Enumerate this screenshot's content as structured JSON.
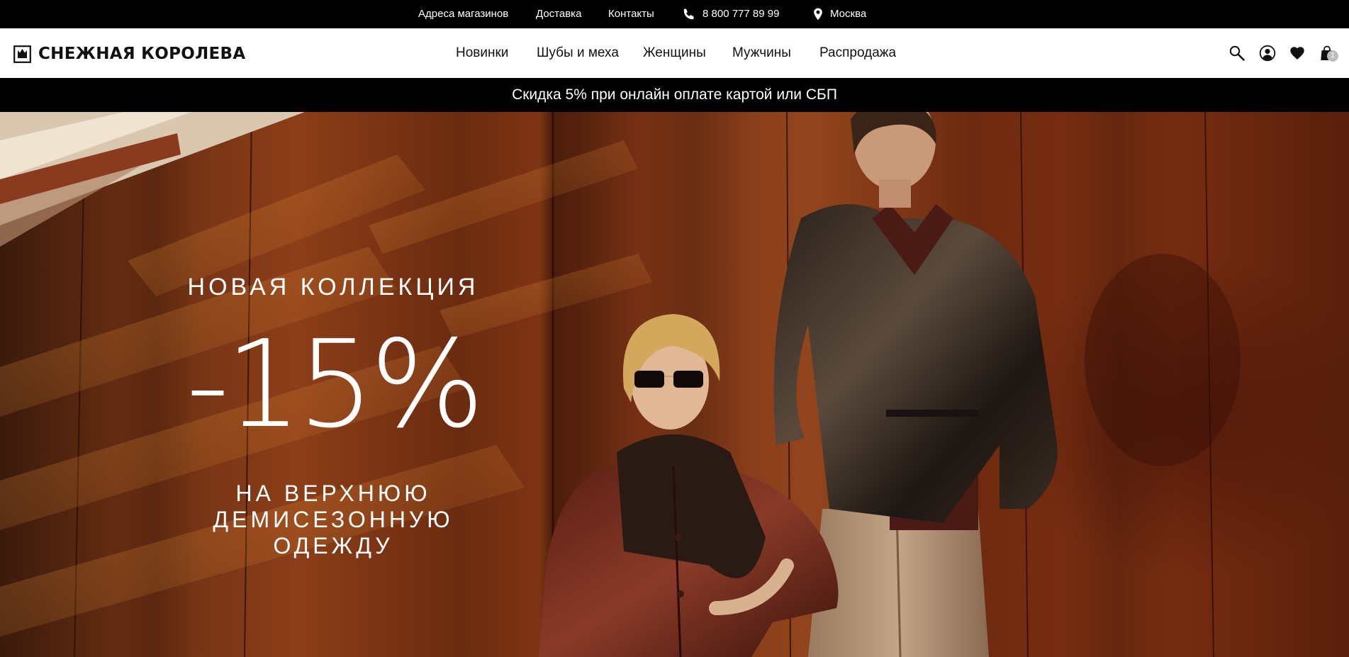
{
  "topbar": {
    "store_addresses": "Адреса магазинов",
    "delivery": "Доставка",
    "contacts": "Контакты",
    "phone": "8 800 777 89 99",
    "city": "Москва",
    "icons": {
      "phone": "phone-icon",
      "location": "map-pin-icon"
    }
  },
  "header": {
    "logo_text": "СНЕЖНАЯ КОРОЛЕВА",
    "nav": [
      "Новинки",
      "Шубы и меха",
      "Женщины",
      "Мужчины",
      "Распродажа"
    ],
    "icons": [
      "search-icon",
      "user-icon",
      "heart-icon",
      "cart-icon"
    ],
    "cart_count": "1"
  },
  "promo": {
    "text": "Скидка 5% при онлайн оплате картой или СБП"
  },
  "hero": {
    "eyebrow": "НОВАЯ КОЛЛЕКЦИЯ",
    "discount": "-15%",
    "subtitle_lines": [
      "НА ВЕРХНЮЮ",
      "ДЕМИСЕЗОННУЮ",
      "ОДЕЖДУ"
    ]
  },
  "colors": {
    "topbar_bg": "#000000",
    "header_bg": "#ffffff",
    "promo_bg": "#000000",
    "text_dark": "#111111",
    "hero_wood": "#7e3414"
  }
}
